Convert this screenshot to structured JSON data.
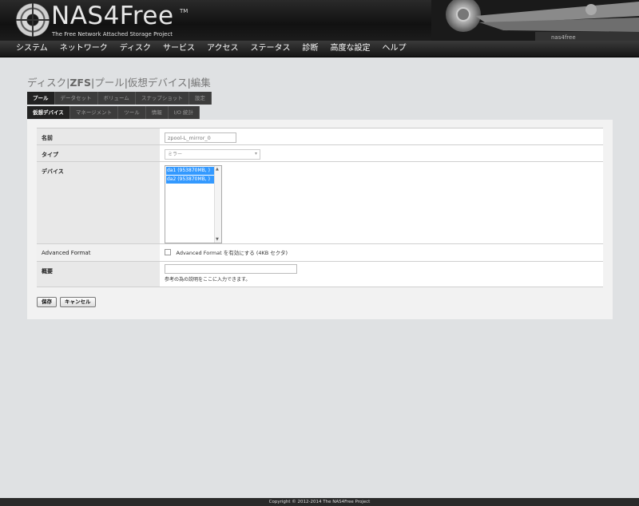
{
  "header": {
    "logo_name": "NAS4Free",
    "logo_tm": "TM",
    "tagline": "The Free Network Attached Storage Project"
  },
  "menu": [
    "システム",
    "ネットワーク",
    "ディスク",
    "サービス",
    "アクセス",
    "ステータス",
    "診断",
    "高度な設定",
    "ヘルプ"
  ],
  "breadcrumb": {
    "part1": "ディスク",
    "part2": "ZFS",
    "part3": "プール",
    "part4": "仮想デバイス",
    "part5": "編集",
    "separator": "|"
  },
  "tabs_row1": [
    "プール",
    "データセット",
    "ボリューム",
    "スナップショット",
    "設定"
  ],
  "tabs_row2": [
    "仮想デバイス",
    "マネージメント",
    "ツール",
    "情報",
    "I/O 統計"
  ],
  "form": {
    "name_label": "名前",
    "name_value": "zpool-L_mirror_0",
    "type_label": "タイプ",
    "type_value": "ミラー",
    "devices_label": "デバイス",
    "devices": [
      "da1 (953870MB, )",
      "da2 (953870MB, )"
    ],
    "advanced_label": "Advanced Format",
    "advanced_checkbox_text": "Advanced Format を有効にする (4KB セクタ)",
    "desc_label": "概要",
    "desc_value": "",
    "desc_hint": "参考の為の説明をここに入力できます。"
  },
  "buttons": {
    "save": "保存",
    "cancel": "キャンセル"
  },
  "footer": "Copyright © 2012-2014 The NAS4Free Project"
}
